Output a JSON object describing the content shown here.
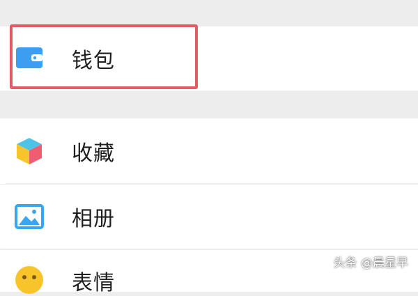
{
  "menu": {
    "items": [
      {
        "label": "钱包",
        "icon": "wallet-icon"
      },
      {
        "label": "收藏",
        "icon": "favorites-cube-icon"
      },
      {
        "label": "相册",
        "icon": "album-picture-icon"
      },
      {
        "label": "表情",
        "icon": "emoji-face-icon"
      }
    ]
  },
  "watermark": "头条 @晨星早",
  "colors": {
    "highlight_border": "#e05d63",
    "wallet_blue": "#3d9ef0",
    "album_blue": "#38a6f2",
    "emoji_yellow": "#f7c52b"
  }
}
